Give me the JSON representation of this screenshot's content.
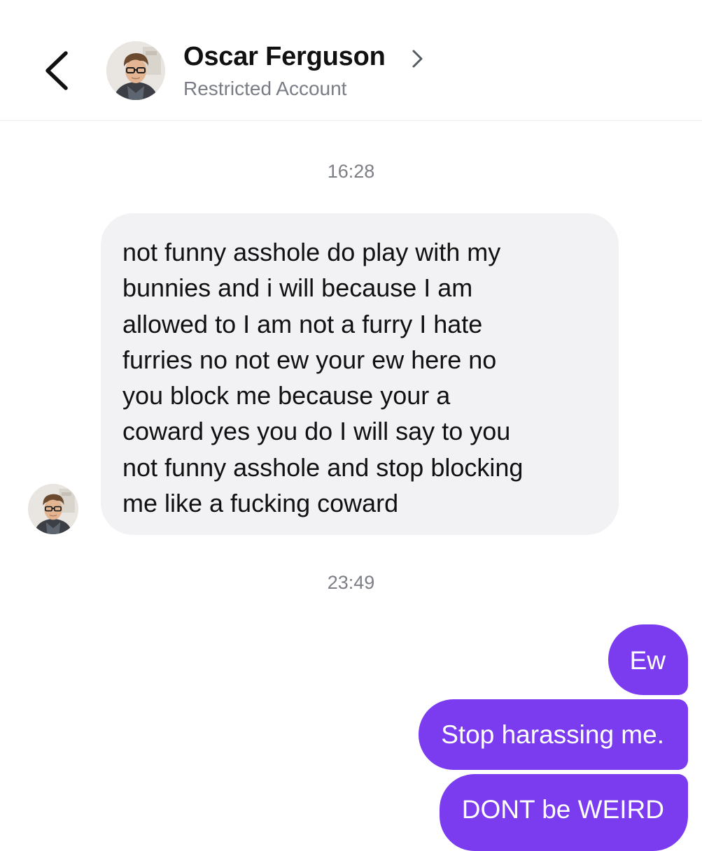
{
  "header": {
    "contact_name": "Oscar Ferguson",
    "account_status": "Restricted Account",
    "back_icon": "chevron-left-icon",
    "name_chevron_icon": "chevron-right-icon"
  },
  "conversation": {
    "groups": [
      {
        "timestamp": "16:28",
        "messages": [
          {
            "direction": "incoming",
            "lines": [
              "not funny asshole do play with my",
              "bunnies and i will because I am",
              "allowed to I am not a furry I hate",
              "furries no not ew your ew here no",
              "you block me because your a",
              "coward yes you do I will say to you",
              "not funny asshole and stop blocking",
              "me like a fucking coward"
            ]
          }
        ]
      },
      {
        "timestamp": "23:49",
        "messages": [
          {
            "direction": "outgoing",
            "text": "Ew"
          },
          {
            "direction": "outgoing",
            "text": "Stop harassing me."
          },
          {
            "direction": "outgoing",
            "text": "DONT be WEIRD"
          }
        ]
      }
    ]
  },
  "colors": {
    "outgoing_bubble": "#7b3cf0",
    "incoming_bubble": "#f2f2f5",
    "secondary_text": "#7a7d85"
  }
}
